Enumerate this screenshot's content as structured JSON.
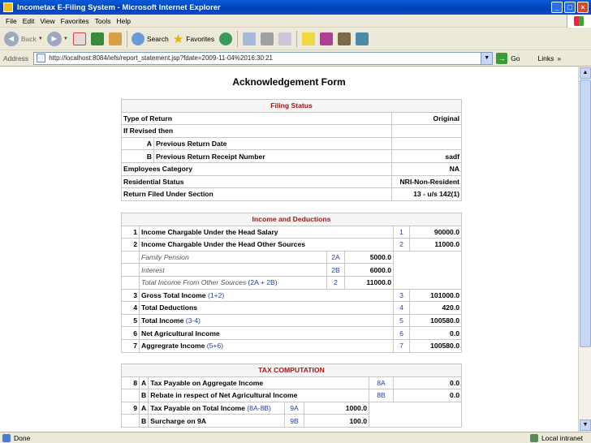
{
  "window": {
    "title": "Incometax E-Filing System - Microsoft Internet Explorer"
  },
  "menu": [
    "File",
    "Edit",
    "View",
    "Favorites",
    "Tools",
    "Help"
  ],
  "toolbar": {
    "back": "Back",
    "search": "Search",
    "favorites": "Favorites"
  },
  "address": {
    "label": "Address",
    "url": "http://localhost:8084/iefs/report_statement.jsp?fdate=2009-11-04%2016:30:21",
    "go": "Go",
    "links": "Links"
  },
  "page": {
    "title": "Acknowledgement Form"
  },
  "filing": {
    "header": "Filing Status",
    "rows": [
      {
        "label": "Type of Return",
        "value": "Original"
      },
      {
        "label": "If Revised then",
        "value": ""
      }
    ],
    "revised": [
      {
        "code": "A",
        "label": "Previous Return Date",
        "value": ""
      },
      {
        "code": "B",
        "label": "Previous Return Receipt Number",
        "value": "sadf"
      }
    ],
    "rows2": [
      {
        "label": "Employees Category",
        "value": "NA"
      },
      {
        "label": "Residential Status",
        "value": "NRI-Non-Resident"
      },
      {
        "label": "Return Filed Under Section",
        "value": "13 - u/s 142(1)"
      }
    ]
  },
  "income": {
    "header": "Income and Deductions",
    "rows": [
      {
        "no": "1",
        "label": "Income Chargable Under the Head Salary",
        "ref": "",
        "code": "1",
        "value": "90000.0"
      },
      {
        "no": "2",
        "label": "Income Chargable Under the Head Other Sources",
        "ref": "",
        "code": "2",
        "value": "11000.0"
      }
    ],
    "sub": [
      {
        "label": "Family Pension",
        "ref": "",
        "code": "2A",
        "value": "5000.0"
      },
      {
        "label": "Interest",
        "ref": "",
        "code": "2B",
        "value": "6000.0"
      },
      {
        "label": "Total Income From Other Sources ",
        "ref": "(2A + 2B)",
        "code": "2",
        "value": "11000.0"
      }
    ],
    "rows2": [
      {
        "no": "3",
        "label": "Gross Total Income ",
        "ref": "(1+2)",
        "code": "3",
        "value": "101000.0"
      },
      {
        "no": "4",
        "label": "Total Deductions",
        "ref": "",
        "code": "4",
        "value": "420.0"
      },
      {
        "no": "5",
        "label": "Total Income ",
        "ref": "(3-4)",
        "code": "5",
        "value": "100580.0"
      },
      {
        "no": "6",
        "label": "Net Agricultural Income",
        "ref": "",
        "code": "6",
        "value": "0.0"
      },
      {
        "no": "7",
        "label": "Aggregrate Income ",
        "ref": "(5+6)",
        "code": "7",
        "value": "100580.0"
      }
    ]
  },
  "tax": {
    "header": "TAX COMPUTATION",
    "rows": [
      {
        "no": "8",
        "letter": "A",
        "label": "Tax Payable on Aggregate Income",
        "ref": "",
        "code": "8A",
        "value": "0.0"
      },
      {
        "no": "",
        "letter": "B",
        "label": "Rebate in respect of Net Agricultural Income",
        "ref": "",
        "code": "8B",
        "value": "0.0"
      }
    ],
    "rows2": [
      {
        "no": "9",
        "letter": "A",
        "label": "Tax Payable on Total Income ",
        "ref": "(8A-8B)",
        "code": "9A",
        "value": "1000.0"
      },
      {
        "no": "",
        "letter": "B",
        "label": "Surcharge on 9A",
        "ref": "",
        "code": "9B",
        "value": "100.0"
      }
    ]
  },
  "status": {
    "left": "Done",
    "right": "Local intranet"
  }
}
